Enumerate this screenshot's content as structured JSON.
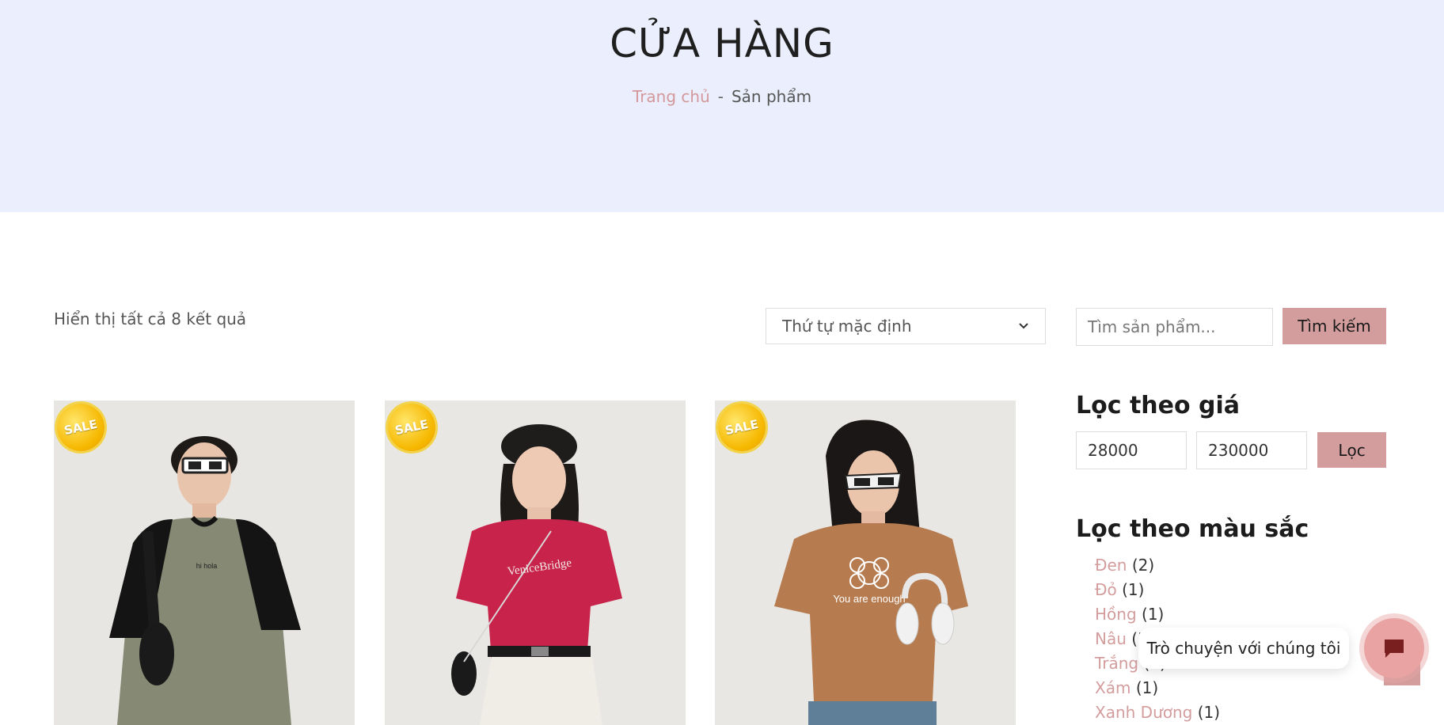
{
  "hero": {
    "title": "CỬA HÀNG",
    "breadcrumb_home": "Trang chủ",
    "breadcrumb_separator": "-",
    "breadcrumb_current": "Sản phẩm"
  },
  "toolbar": {
    "result_count": "Hiển thị tất cả 8 kết quả",
    "sort_selected": "Thứ tự mặc định",
    "search_placeholder": "Tìm sản phẩm...",
    "search_button": "Tìm kiếm"
  },
  "products": [
    {
      "badge": "SALE",
      "shirt_text": "hi hola"
    },
    {
      "badge": "SALE",
      "shirt_text": "VeniceBridge"
    },
    {
      "badge": "SALE",
      "shirt_text": "You are enough"
    }
  ],
  "price_filter": {
    "title": "Lọc theo giá",
    "min": "28000",
    "max": "230000",
    "button": "Lọc"
  },
  "color_filter": {
    "title": "Lọc theo màu sắc",
    "items": [
      {
        "name": "Đen",
        "count": "(2)"
      },
      {
        "name": "Đỏ",
        "count": "(1)"
      },
      {
        "name": "Hồng",
        "count": "(1)"
      },
      {
        "name": "Nâu",
        "count": "(3)"
      },
      {
        "name": "Trắng",
        "count": "(1)"
      },
      {
        "name": "Xám",
        "count": "(1)"
      },
      {
        "name": "Xanh Dương",
        "count": "(1)"
      }
    ]
  },
  "chat": {
    "label": "Trò chuyện với chúng tôi"
  },
  "colors": {
    "hero_bg": "#ebeffd",
    "accent": "#d49d9d",
    "chat_button": "#e9a3a3"
  }
}
